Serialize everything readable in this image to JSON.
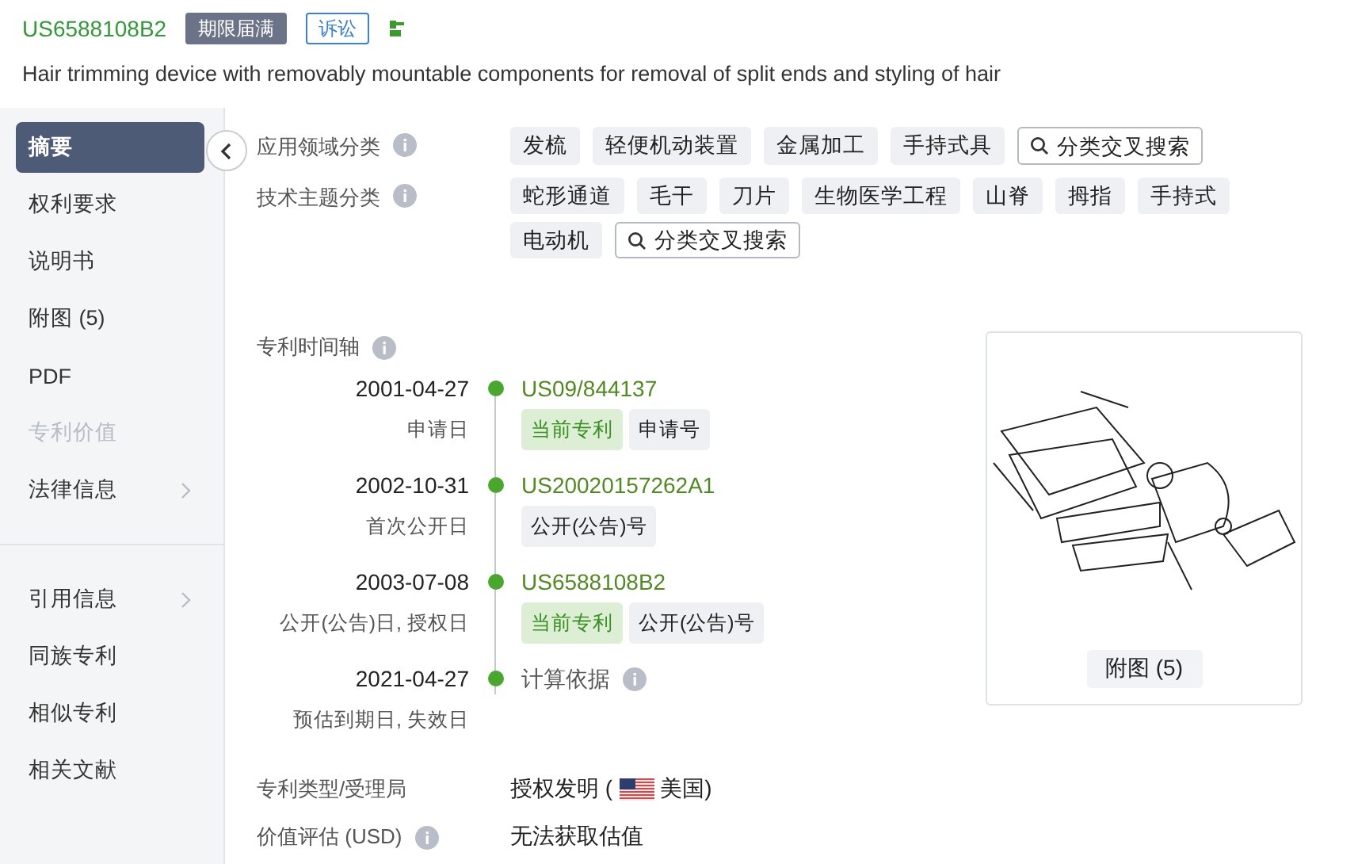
{
  "header": {
    "number": "US6588108B2",
    "badges": [
      {
        "text": "期限届满",
        "kind": "filled"
      },
      {
        "text": "诉讼",
        "kind": "outline"
      }
    ],
    "title": "Hair trimming device with removably mountable components for removal of split ends and styling of hair"
  },
  "sidebar": {
    "groups": [
      [
        {
          "label": "摘要",
          "selected": true,
          "disabled": false,
          "expandable": false
        },
        {
          "label": "权利要求",
          "selected": false,
          "disabled": false,
          "expandable": false
        },
        {
          "label": "说明书",
          "selected": false,
          "disabled": false,
          "expandable": false
        },
        {
          "label": "附图 (5)",
          "selected": false,
          "disabled": false,
          "expandable": false
        },
        {
          "label": "PDF",
          "selected": false,
          "disabled": false,
          "expandable": false
        },
        {
          "label": "专利价值",
          "selected": false,
          "disabled": true,
          "expandable": false
        },
        {
          "label": "法律信息",
          "selected": false,
          "disabled": false,
          "expandable": true
        }
      ],
      [
        {
          "label": "引用信息",
          "selected": false,
          "disabled": false,
          "expandable": true
        },
        {
          "label": "同族专利",
          "selected": false,
          "disabled": false,
          "expandable": false
        },
        {
          "label": "相似专利",
          "selected": false,
          "disabled": false,
          "expandable": false
        },
        {
          "label": "相关文献",
          "selected": false,
          "disabled": false,
          "expandable": false
        }
      ]
    ]
  },
  "classifications": [
    {
      "label": "应用领域分类",
      "tags": [
        "发梳",
        "轻便机动装置",
        "金属加工",
        "手持式具"
      ],
      "search_button": "分类交叉搜索"
    },
    {
      "label": "技术主题分类",
      "tags": [
        "蛇形通道",
        "毛干",
        "刀片",
        "生物医学工程",
        "山脊",
        "拇指",
        "手持式",
        "电动机"
      ],
      "search_button": "分类交叉搜索"
    }
  ],
  "timeline": {
    "label": "专利时间轴",
    "events": [
      {
        "date": "2001-04-27",
        "label": "申请日",
        "number": "US09/844137",
        "kind": "link",
        "tags": [
          {
            "text": "当前专利",
            "kind": "current"
          },
          {
            "text": "申请号",
            "kind": "plain"
          }
        ]
      },
      {
        "date": "2002-10-31",
        "label": "首次公开日",
        "number": "US20020157262A1",
        "kind": "link",
        "tags": [
          {
            "text": "公开(公告)号",
            "kind": "plain"
          }
        ]
      },
      {
        "date": "2003-07-08",
        "label": "公开(公告)日, 授权日",
        "number": "US6588108B2",
        "kind": "link",
        "tags": [
          {
            "text": "当前专利",
            "kind": "current"
          },
          {
            "text": "公开(公告)号",
            "kind": "plain"
          }
        ]
      },
      {
        "date": "2021-04-27",
        "label": "预估到期日, 失效日",
        "number": "计算依据",
        "kind": "note"
      }
    ]
  },
  "figure": {
    "button": "附图 (5)"
  },
  "fields": [
    {
      "label": "专利类型/受理局",
      "info": false,
      "value": "授权发明 (",
      "flag": true,
      "country": "美国)"
    },
    {
      "label": "价值评估 (USD)",
      "info": true,
      "value": "无法获取估值",
      "flag": false
    }
  ]
}
